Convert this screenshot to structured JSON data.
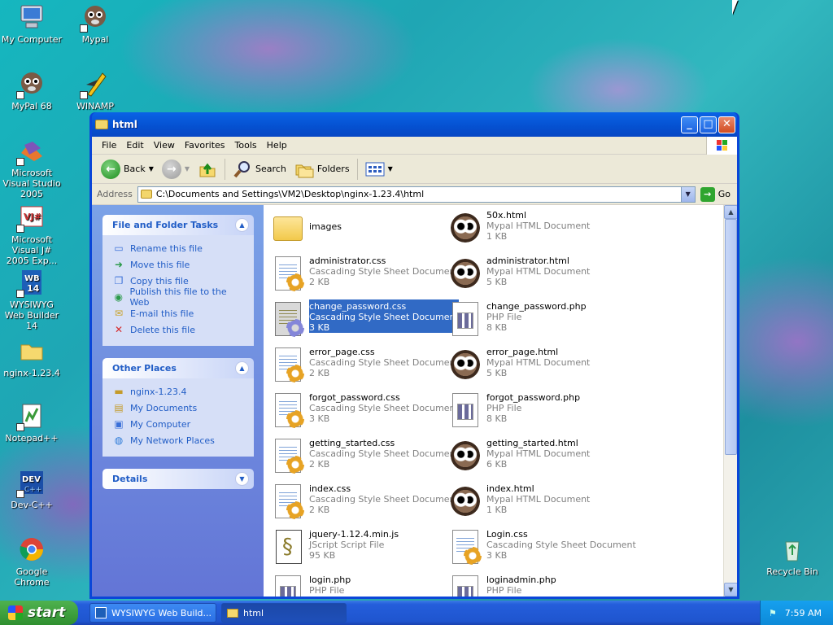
{
  "desktop": {
    "icons": [
      {
        "label": "My Computer",
        "icon": "computer-icon"
      },
      {
        "label": "Mypal",
        "icon": "mypal-icon"
      },
      {
        "label": "MyPal 68",
        "icon": "mypal-icon"
      },
      {
        "label": "WINAMP",
        "icon": "winamp-icon"
      },
      {
        "label": "Microsoft Visual Studio 2005",
        "icon": "visual-studio-icon"
      },
      {
        "label": "Microsoft Visual J# 2005 Exp...",
        "icon": "visual-jsharp-icon"
      },
      {
        "label": "WYSIWYG Web Builder 14",
        "icon": "wysiwyg-icon"
      },
      {
        "label": "nginx-1.23.4",
        "icon": "folder-icon"
      },
      {
        "label": "Notepad++",
        "icon": "notepad-plus-icon"
      },
      {
        "label": "Dev-C++",
        "icon": "devcpp-icon"
      },
      {
        "label": "Google Chrome",
        "icon": "chrome-icon"
      },
      {
        "label": "Recycle Bin",
        "icon": "recycle-bin-icon"
      }
    ]
  },
  "window": {
    "title": "html",
    "menu": [
      "File",
      "Edit",
      "View",
      "Favorites",
      "Tools",
      "Help"
    ],
    "toolbar": {
      "back": "Back",
      "search": "Search",
      "folders": "Folders"
    },
    "address": {
      "label": "Address",
      "value": "C:\\Documents and Settings\\VM2\\Desktop\\nginx-1.23.4\\html",
      "go": "Go"
    },
    "tasks_panel": {
      "title": "File and Folder Tasks",
      "items": [
        {
          "label": "Rename this file",
          "icon": "rename-icon"
        },
        {
          "label": "Move this file",
          "icon": "move-icon"
        },
        {
          "label": "Copy this file",
          "icon": "copy-icon"
        },
        {
          "label": "Publish this file to the Web",
          "icon": "publish-icon"
        },
        {
          "label": "E-mail this file",
          "icon": "email-icon"
        },
        {
          "label": "Delete this file",
          "icon": "delete-icon"
        }
      ]
    },
    "places_panel": {
      "title": "Other Places",
      "items": [
        {
          "label": "nginx-1.23.4",
          "icon": "folder-icon"
        },
        {
          "label": "My Documents",
          "icon": "documents-icon"
        },
        {
          "label": "My Computer",
          "icon": "computer-icon"
        },
        {
          "label": "My Network Places",
          "icon": "network-icon"
        }
      ]
    },
    "details_panel": {
      "title": "Details"
    },
    "files": [
      {
        "name": "images",
        "type": "",
        "size": "",
        "icon": "folder"
      },
      {
        "name": "50x.html",
        "type": "Mypal HTML Document",
        "size": "1 KB",
        "icon": "pal"
      },
      {
        "name": "administrator.css",
        "type": "Cascading Style Sheet Document",
        "size": "2 KB",
        "icon": "css"
      },
      {
        "name": "administrator.html",
        "type": "Mypal HTML Document",
        "size": "5 KB",
        "icon": "pal"
      },
      {
        "name": "change_password.css",
        "type": "Cascading Style Sheet Document",
        "size": "3 KB",
        "icon": "css",
        "selected": true
      },
      {
        "name": "change_password.php",
        "type": "PHP File",
        "size": "8 KB",
        "icon": "php"
      },
      {
        "name": "error_page.css",
        "type": "Cascading Style Sheet Document",
        "size": "2 KB",
        "icon": "css"
      },
      {
        "name": "error_page.html",
        "type": "Mypal HTML Document",
        "size": "5 KB",
        "icon": "pal"
      },
      {
        "name": "forgot_password.css",
        "type": "Cascading Style Sheet Document",
        "size": "3 KB",
        "icon": "css"
      },
      {
        "name": "forgot_password.php",
        "type": "PHP File",
        "size": "8 KB",
        "icon": "php"
      },
      {
        "name": "getting_started.css",
        "type": "Cascading Style Sheet Document",
        "size": "2 KB",
        "icon": "css"
      },
      {
        "name": "getting_started.html",
        "type": "Mypal HTML Document",
        "size": "6 KB",
        "icon": "pal"
      },
      {
        "name": "index.css",
        "type": "Cascading Style Sheet Document",
        "size": "2 KB",
        "icon": "css"
      },
      {
        "name": "index.html",
        "type": "Mypal HTML Document",
        "size": "1 KB",
        "icon": "pal"
      },
      {
        "name": "jquery-1.12.4.min.js",
        "type": "JScript Script File",
        "size": "95 KB",
        "icon": "js"
      },
      {
        "name": "Login.css",
        "type": "Cascading Style Sheet Document",
        "size": "3 KB",
        "icon": "css"
      },
      {
        "name": "login.php",
        "type": "PHP File",
        "size": "",
        "icon": "php"
      },
      {
        "name": "loginadmin.php",
        "type": "PHP File",
        "size": "",
        "icon": "php"
      }
    ]
  },
  "taskbar": {
    "start": "start",
    "tasks": [
      {
        "label": "WYSIWYG Web Build...",
        "active": false
      },
      {
        "label": "html",
        "active": true
      }
    ],
    "help": "?",
    "clock": "7:59 AM"
  }
}
